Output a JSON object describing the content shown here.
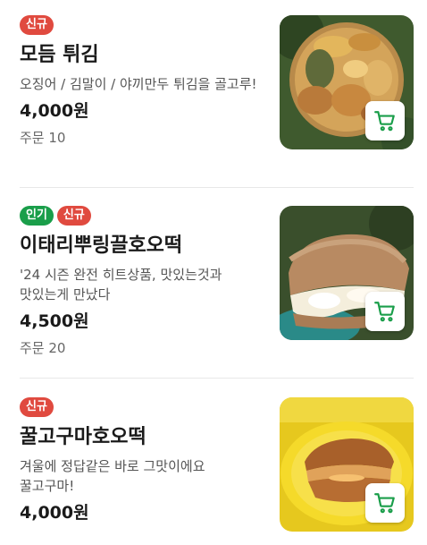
{
  "menu": {
    "items": [
      {
        "badges": [
          {
            "label": "신규",
            "color": "#e04a3f"
          }
        ],
        "name": "모듬 튀김",
        "description": "오징어 / 김말이 / 야끼만두 튀김을 골고루!",
        "price": "4,000원",
        "orders": "주문 10",
        "photo": "fried-assortment-photo"
      },
      {
        "badges": [
          {
            "label": "인기",
            "color": "#1a9e4a"
          },
          {
            "label": "신규",
            "color": "#e04a3f"
          }
        ],
        "name": "이태리뿌링끌호오떡",
        "description": "'24 시즌 완전 히트상품, 맛있는것과 맛있는게 만났다",
        "price": "4,500원",
        "orders": "주문 20",
        "photo": "cheese-hotteok-photo"
      },
      {
        "badges": [
          {
            "label": "신규",
            "color": "#e04a3f"
          }
        ],
        "name": "꿀고구마호오떡",
        "description": "겨울에 정답같은 바로 그맛이에요 꿀고구마!",
        "price": "4,000원",
        "photo": "sweet-potato-hotteok-photo"
      }
    ],
    "cart_icon": "cart-icon",
    "cart_color": "#1a9e4a"
  }
}
